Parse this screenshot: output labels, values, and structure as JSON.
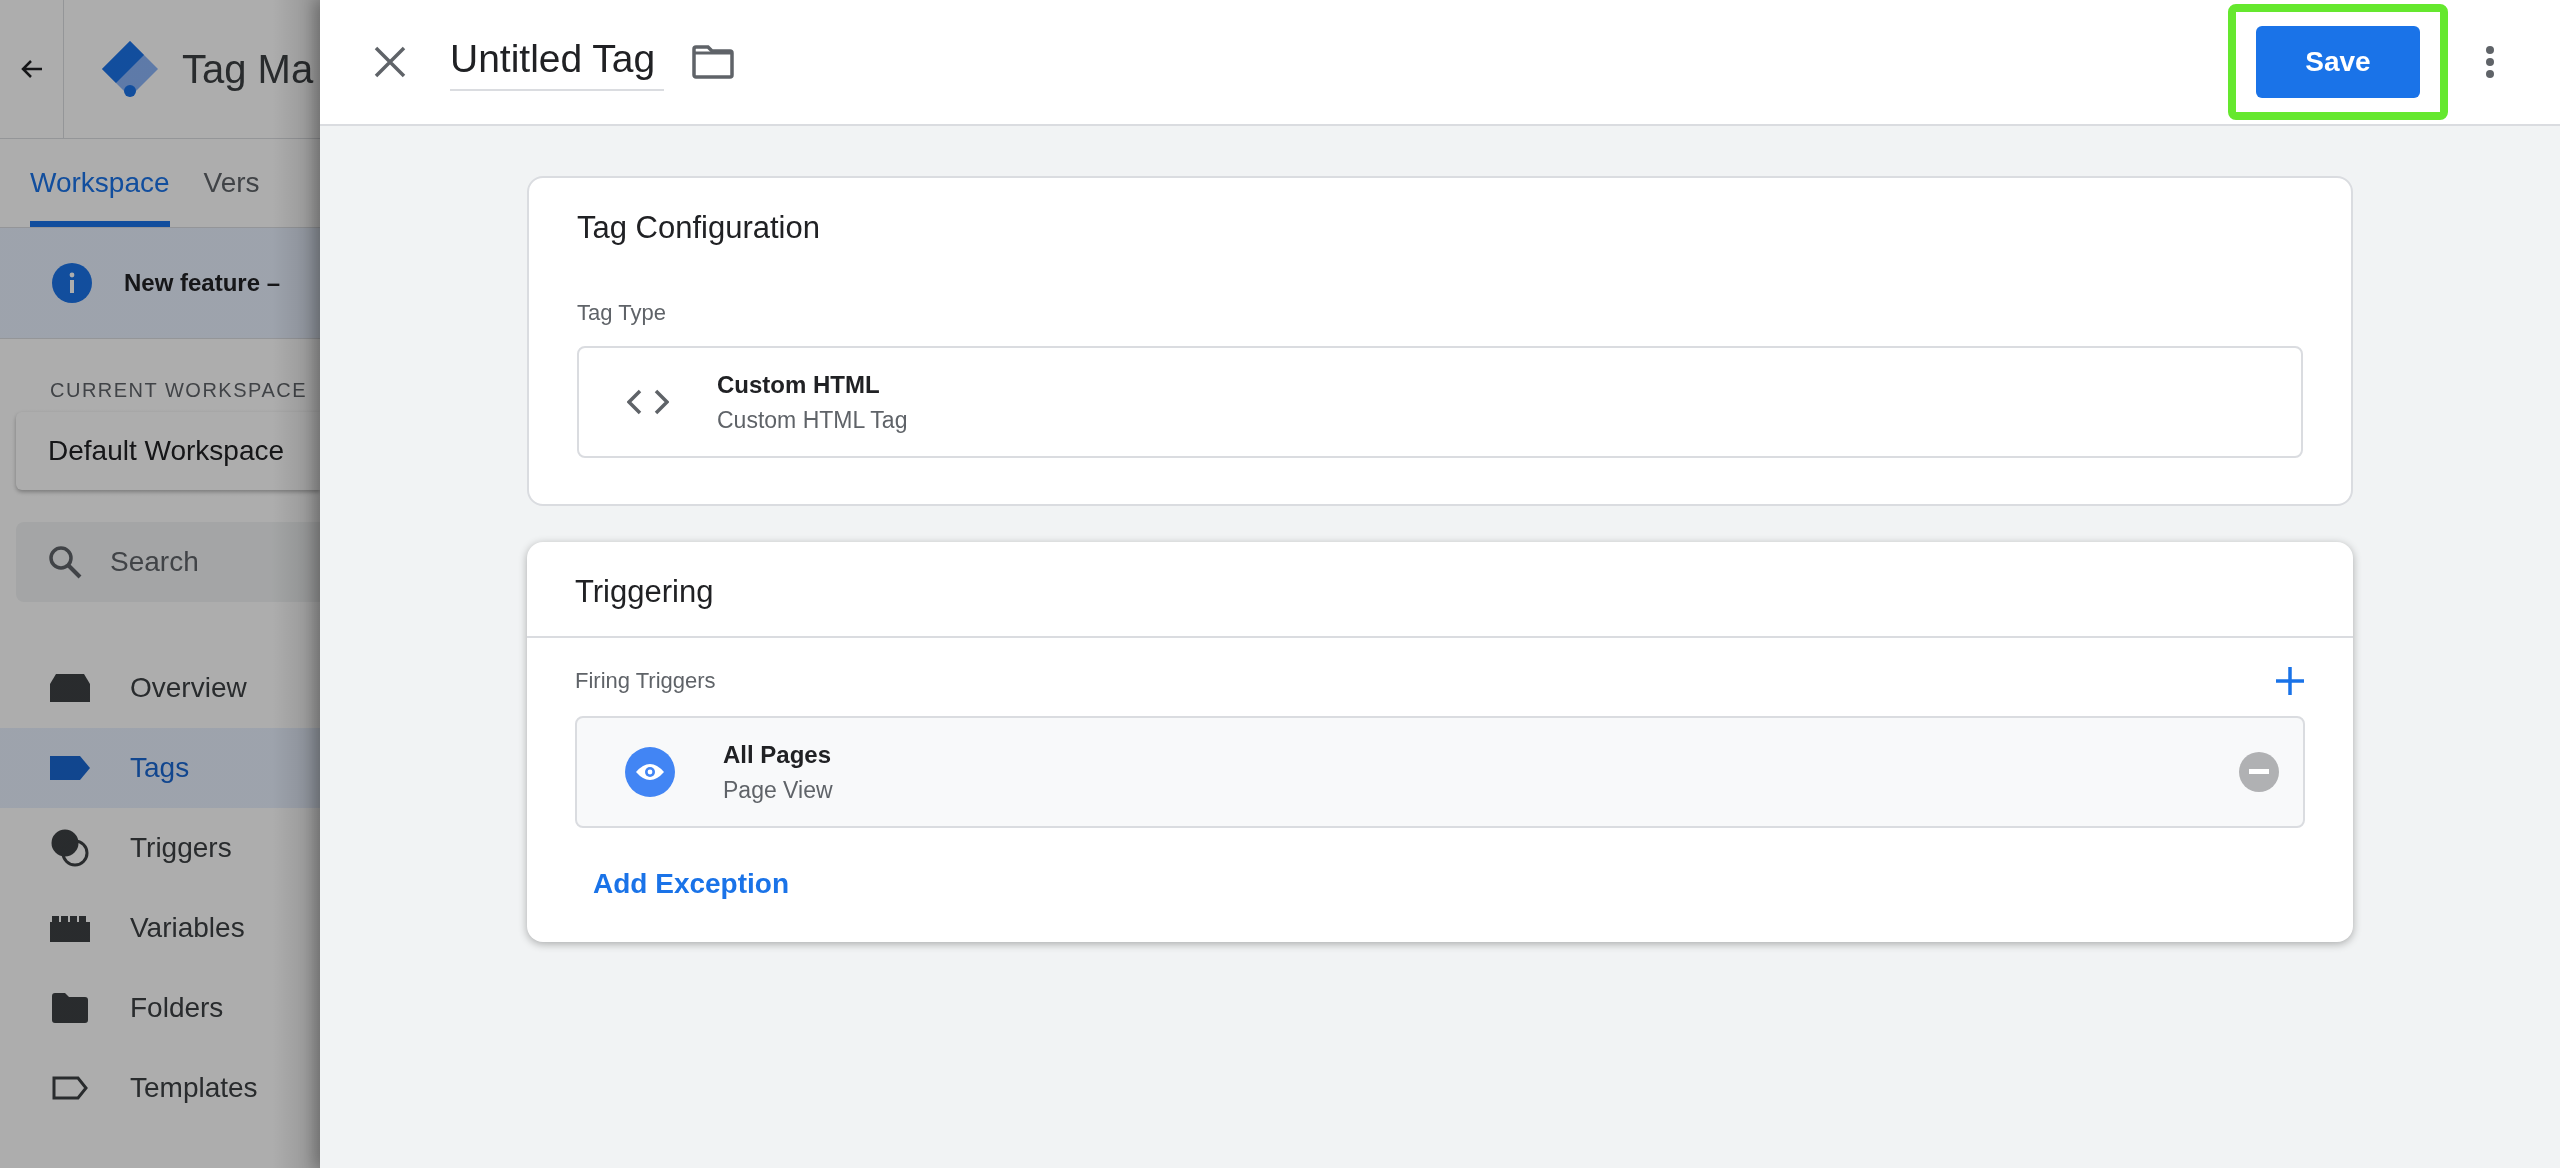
{
  "sidebar": {
    "app_title": "Tag Ma",
    "tabs": [
      {
        "label": "Workspace",
        "selected": true
      },
      {
        "label": "Vers",
        "selected": false
      }
    ],
    "banner": {
      "text": "New feature –"
    },
    "workspace_label": "CURRENT WORKSPACE",
    "workspace": "Default Workspace",
    "search": {
      "placeholder": "Search"
    },
    "nav": [
      {
        "label": "Overview",
        "kind": "overview",
        "selected": false
      },
      {
        "label": "Tags",
        "kind": "tags",
        "selected": true
      },
      {
        "label": "Triggers",
        "kind": "triggers",
        "selected": false
      },
      {
        "label": "Variables",
        "kind": "variables",
        "selected": false
      },
      {
        "label": "Folders",
        "kind": "folders",
        "selected": false
      },
      {
        "label": "Templates",
        "kind": "templates",
        "selected": false
      }
    ]
  },
  "editor": {
    "title": "Untitled Tag",
    "save": {
      "label": "Save",
      "highlighted": true
    },
    "tag_configuration": {
      "title": "Tag Configuration",
      "field_label": "Tag Type",
      "type": {
        "name": "Custom HTML",
        "description": "Custom HTML Tag"
      }
    },
    "triggering": {
      "title": "Triggering",
      "field_label": "Firing Triggers",
      "triggers": [
        {
          "name": "All Pages",
          "description": "Page View"
        }
      ],
      "exception_label": "Add Exception"
    }
  }
}
